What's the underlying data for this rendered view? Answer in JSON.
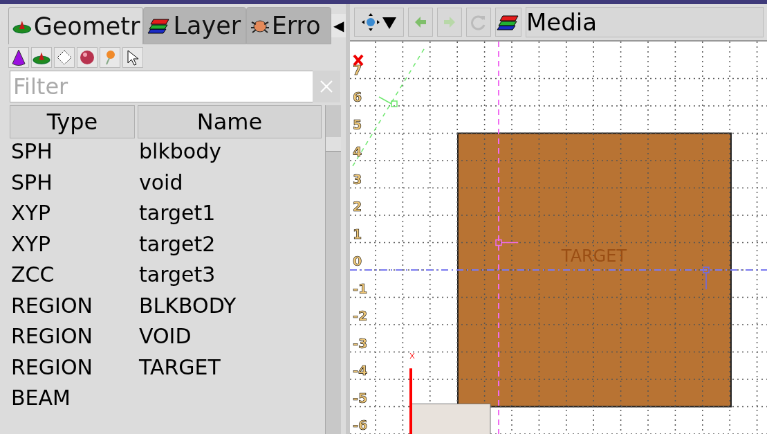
{
  "left_panel": {
    "tabs": [
      {
        "label": "Geometr",
        "selected": true
      },
      {
        "label": "Layer",
        "selected": false
      },
      {
        "label": "Erro",
        "selected": false
      }
    ],
    "tab_scroll": "◀",
    "filter": {
      "placeholder": "Filter"
    },
    "table": {
      "columns": [
        "Type",
        "Name"
      ],
      "rows": [
        {
          "type": "SPH",
          "name": "blkbody"
        },
        {
          "type": "SPH",
          "name": "void"
        },
        {
          "type": "XYP",
          "name": "target1"
        },
        {
          "type": "XYP",
          "name": "target2"
        },
        {
          "type": "ZCC",
          "name": "target3"
        },
        {
          "type": "REGION",
          "name": "BLKBODY"
        },
        {
          "type": "REGION",
          "name": "VOID"
        },
        {
          "type": "REGION",
          "name": "TARGET"
        },
        {
          "type": "BEAM"
        }
      ]
    }
  },
  "viewport": {
    "layer": "Media",
    "y_labels": [
      "7",
      "6",
      "5",
      "4",
      "3",
      "2",
      "1",
      "0",
      "-1",
      "-2",
      "-3",
      "-4",
      "-5",
      "-6"
    ],
    "region_label": "TARGET"
  }
}
